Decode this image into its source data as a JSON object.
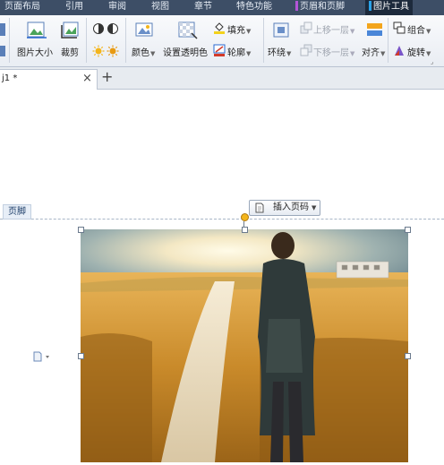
{
  "menu_tabs": [
    {
      "label": "页面布局"
    },
    {
      "label": "引用"
    },
    {
      "label": "审阅"
    },
    {
      "label": "视图"
    },
    {
      "label": "章节"
    },
    {
      "label": "特色功能"
    },
    {
      "label": "页眉和页脚"
    },
    {
      "label": "图片工具"
    }
  ],
  "ribbon": {
    "picture_size": "图片大小",
    "crop": "裁剪",
    "color": "颜色",
    "set_transparent": "设置透明色",
    "fill": "填充",
    "outline": "轮廓",
    "wrap": "环绕",
    "bring_forward": "上移一层",
    "send_backward": "下移一层",
    "align": "对齐",
    "group": "组合",
    "rotate": "旋转"
  },
  "doc_tab": {
    "name": "j1 *",
    "close": "×",
    "new": "+"
  },
  "canvas": {
    "footer_label": "页脚",
    "insert_page_number": "插入页码"
  },
  "colors": {
    "menubar": "#3d4e66",
    "header_footer_accent": "#b455d8",
    "picture_tools_accent": "#2aa2e8",
    "footer_guide": "#a8b6c8"
  }
}
